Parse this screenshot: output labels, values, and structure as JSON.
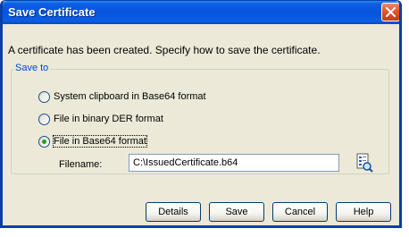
{
  "dialog": {
    "title": "Save Certificate",
    "description": "A certificate has been created.  Specify how to save the certificate."
  },
  "save_to": {
    "legend": "Save to",
    "options": [
      {
        "label": "System clipboard in Base64 format",
        "selected": false
      },
      {
        "label": "File in binary DER format",
        "selected": false
      },
      {
        "label": "File in Base64 format",
        "selected": true
      }
    ],
    "filename_label": "Filename:",
    "filename_value": "C:\\IssuedCertificate.b64"
  },
  "buttons": {
    "details": "Details",
    "save": "Save",
    "cancel": "Cancel",
    "help": "Help"
  },
  "colors": {
    "titlebar": "#0654dc",
    "legend_text": "#0046d5",
    "dialog_bg": "#ece9d8",
    "radio_dot": "#21a121"
  },
  "icons": {
    "close": "close-icon",
    "browse": "browse-file-icon"
  }
}
